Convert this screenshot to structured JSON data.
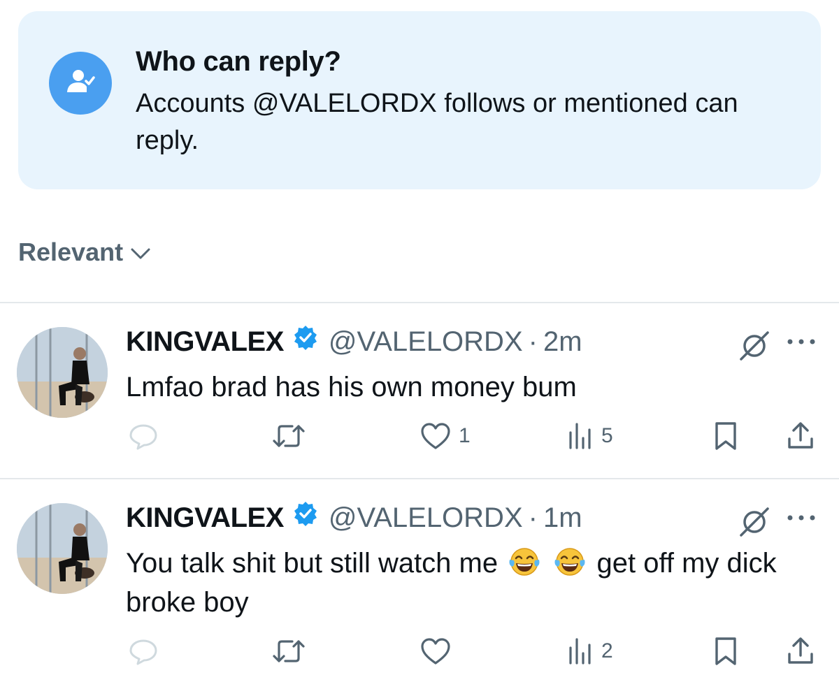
{
  "reply_settings": {
    "title": "Who can reply?",
    "description": "Accounts @VALELORDX follows or mentioned can reply.",
    "icon": "person-check-icon"
  },
  "sort": {
    "label": "Relevant",
    "icon": "chevron-down-icon"
  },
  "tweets": [
    {
      "name": "KINGVALEX",
      "verified": true,
      "handle": "@VALELORDX",
      "separator": "·",
      "time": "2m",
      "text_before": "Lmfao brad has his own money bum",
      "emojis": [],
      "text_after": "",
      "stats": {
        "replies": "",
        "retweets": "",
        "likes": "1",
        "views": "5"
      }
    },
    {
      "name": "KINGVALEX",
      "verified": true,
      "handle": "@VALELORDX",
      "separator": "·",
      "time": "1m",
      "text_before": "You talk shit but still watch me",
      "emojis": [
        "face-with-tears-of-joy",
        "face-with-tears-of-joy"
      ],
      "text_after": "get off my dick broke boy",
      "stats": {
        "replies": "",
        "retweets": "",
        "likes": "",
        "views": "2"
      }
    }
  ],
  "colors": {
    "card_bg": "#e8f4fd",
    "accent": "#1d9bf0",
    "muted": "#536471",
    "text": "#0f1419"
  }
}
